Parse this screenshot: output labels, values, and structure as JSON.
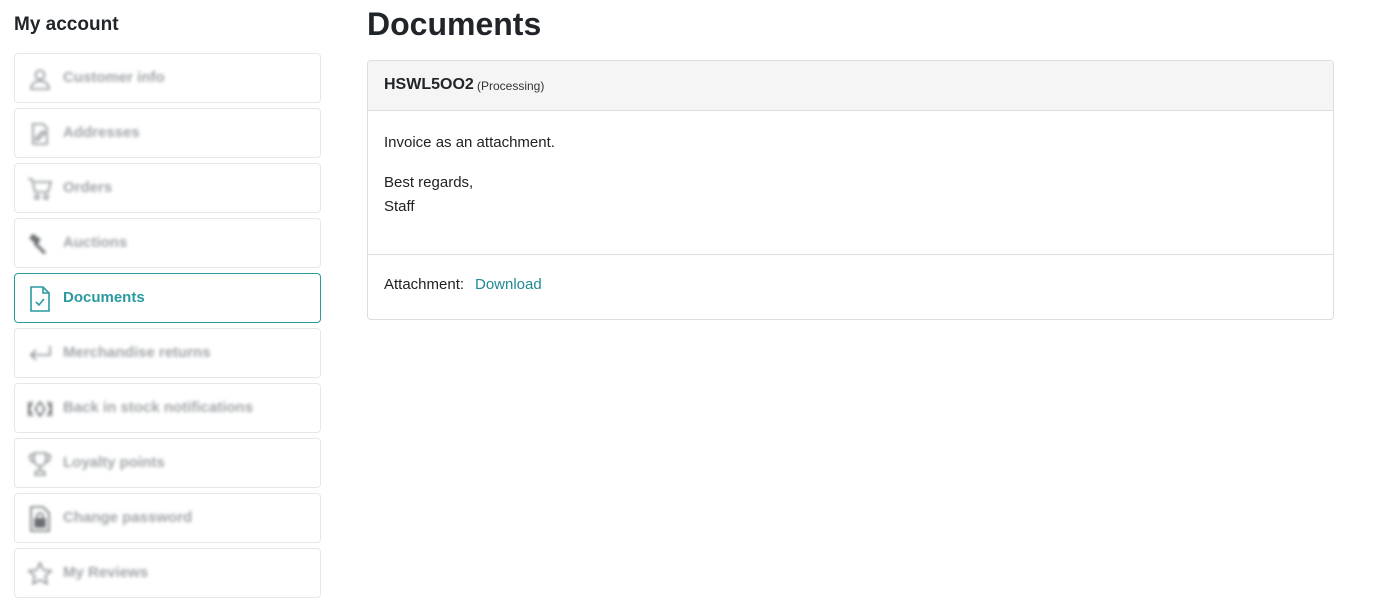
{
  "sidebar": {
    "title": "My account",
    "items": [
      {
        "label": "Customer info",
        "icon": "user-icon",
        "active": false
      },
      {
        "label": "Addresses",
        "icon": "address-card-icon",
        "active": false
      },
      {
        "label": "Orders",
        "icon": "cart-icon",
        "active": false
      },
      {
        "label": "Auctions",
        "icon": "hammer-icon",
        "active": false
      },
      {
        "label": "Documents",
        "icon": "document-check-icon",
        "active": true
      },
      {
        "label": "Merchandise returns",
        "icon": "return-arrow-icon",
        "active": false
      },
      {
        "label": "Back in stock notifications",
        "icon": "stock-notification-icon",
        "active": false
      },
      {
        "label": "Loyalty points",
        "icon": "trophy-icon",
        "active": false
      },
      {
        "label": "Change password",
        "icon": "lock-document-icon",
        "active": false
      },
      {
        "label": "My Reviews",
        "icon": "star-icon",
        "active": false
      }
    ]
  },
  "main": {
    "title": "Documents",
    "document": {
      "id": "HSWL5OO2",
      "status": "(Processing)",
      "body_line1": "Invoice as an attachment.",
      "body_line2": "Best regards,",
      "body_line3": "Staff",
      "attachment_label": "Attachment:",
      "attachment_link": "Download"
    }
  },
  "colors": {
    "accent": "#2a9aa0",
    "link": "#1f8a93",
    "muted_text": "#a0a4a8",
    "header_bg": "#f5f5f5",
    "border": "#dcdfe2"
  }
}
